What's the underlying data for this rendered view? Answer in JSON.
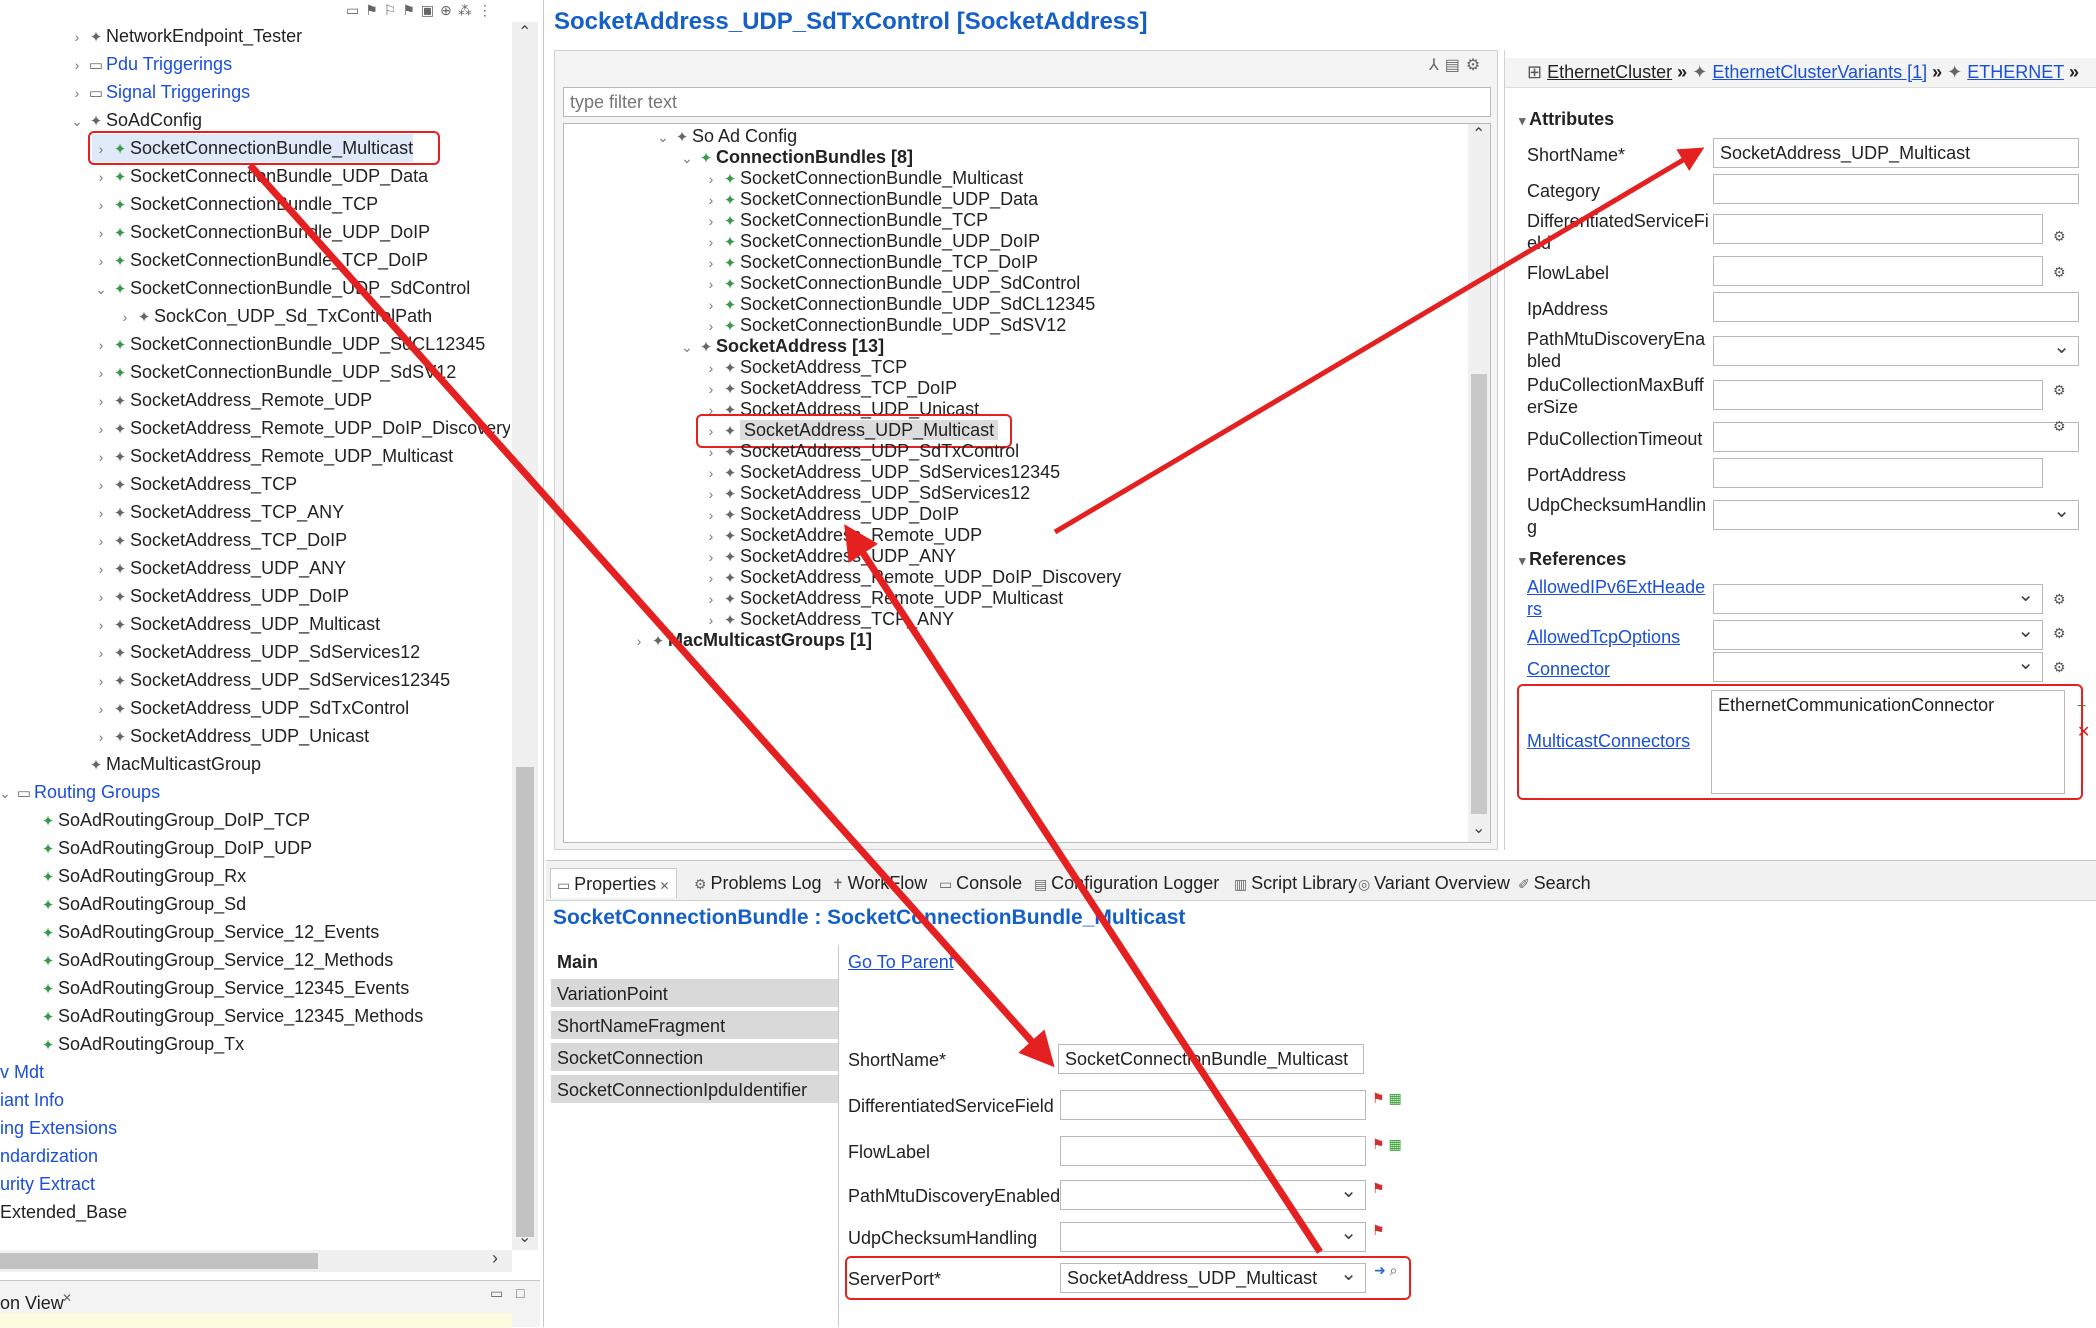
{
  "left_tree": {
    "items": [
      {
        "label": "NetworkEndpoint_Tester",
        "indent": 3,
        "chev": "›",
        "icon": "✦",
        "iconClass": "d",
        "cls": ""
      },
      {
        "label": "Pdu Triggerings",
        "indent": 3,
        "chev": "›",
        "icon": "▭",
        "iconClass": "d",
        "cls": "blue"
      },
      {
        "label": "Signal Triggerings",
        "indent": 3,
        "chev": "›",
        "icon": "▭",
        "iconClass": "d",
        "cls": "blue"
      },
      {
        "label": "SoAdConfig",
        "indent": 3,
        "chev": "⌄",
        "icon": "✦",
        "iconClass": "d",
        "cls": ""
      },
      {
        "label": "SocketConnectionBundle_Multicast",
        "indent": 4,
        "chev": "›",
        "icon": "✦",
        "iconClass": "g",
        "cls": "sel"
      },
      {
        "label": "SocketConnectionBundle_UDP_Data",
        "indent": 4,
        "chev": "›",
        "icon": "✦",
        "iconClass": "g",
        "cls": ""
      },
      {
        "label": "SocketConnectionBundle_TCP",
        "indent": 4,
        "chev": "›",
        "icon": "✦",
        "iconClass": "g",
        "cls": ""
      },
      {
        "label": "SocketConnectionBundle_UDP_DoIP",
        "indent": 4,
        "chev": "›",
        "icon": "✦",
        "iconClass": "g",
        "cls": ""
      },
      {
        "label": "SocketConnectionBundle_TCP_DoIP",
        "indent": 4,
        "chev": "›",
        "icon": "✦",
        "iconClass": "g",
        "cls": ""
      },
      {
        "label": "SocketConnectionBundle_UDP_SdControl",
        "indent": 4,
        "chev": "⌄",
        "icon": "✦",
        "iconClass": "g",
        "cls": ""
      },
      {
        "label": "SockCon_UDP_Sd_TxControlPath",
        "indent": 5,
        "chev": "›",
        "icon": "✦",
        "iconClass": "d",
        "cls": ""
      },
      {
        "label": "SocketConnectionBundle_UDP_SdCL12345",
        "indent": 4,
        "chev": "›",
        "icon": "✦",
        "iconClass": "g",
        "cls": ""
      },
      {
        "label": "SocketConnectionBundle_UDP_SdSV12",
        "indent": 4,
        "chev": "›",
        "icon": "✦",
        "iconClass": "g",
        "cls": ""
      },
      {
        "label": "SocketAddress_Remote_UDP",
        "indent": 4,
        "chev": "›",
        "icon": "✦",
        "iconClass": "d",
        "cls": ""
      },
      {
        "label": "SocketAddress_Remote_UDP_DoIP_Discovery",
        "indent": 4,
        "chev": "›",
        "icon": "✦",
        "iconClass": "d",
        "cls": ""
      },
      {
        "label": "SocketAddress_Remote_UDP_Multicast",
        "indent": 4,
        "chev": "›",
        "icon": "✦",
        "iconClass": "d",
        "cls": ""
      },
      {
        "label": "SocketAddress_TCP",
        "indent": 4,
        "chev": "›",
        "icon": "✦",
        "iconClass": "d",
        "cls": ""
      },
      {
        "label": "SocketAddress_TCP_ANY",
        "indent": 4,
        "chev": "›",
        "icon": "✦",
        "iconClass": "d",
        "cls": ""
      },
      {
        "label": "SocketAddress_TCP_DoIP",
        "indent": 4,
        "chev": "›",
        "icon": "✦",
        "iconClass": "d",
        "cls": ""
      },
      {
        "label": "SocketAddress_UDP_ANY",
        "indent": 4,
        "chev": "›",
        "icon": "✦",
        "iconClass": "d",
        "cls": ""
      },
      {
        "label": "SocketAddress_UDP_DoIP",
        "indent": 4,
        "chev": "›",
        "icon": "✦",
        "iconClass": "d",
        "cls": ""
      },
      {
        "label": "SocketAddress_UDP_Multicast",
        "indent": 4,
        "chev": "›",
        "icon": "✦",
        "iconClass": "d",
        "cls": ""
      },
      {
        "label": "SocketAddress_UDP_SdServices12",
        "indent": 4,
        "chev": "›",
        "icon": "✦",
        "iconClass": "d",
        "cls": ""
      },
      {
        "label": "SocketAddress_UDP_SdServices12345",
        "indent": 4,
        "chev": "›",
        "icon": "✦",
        "iconClass": "d",
        "cls": ""
      },
      {
        "label": "SocketAddress_UDP_SdTxControl",
        "indent": 4,
        "chev": "›",
        "icon": "✦",
        "iconClass": "d",
        "cls": ""
      },
      {
        "label": "SocketAddress_UDP_Unicast",
        "indent": 4,
        "chev": "›",
        "icon": "✦",
        "iconClass": "d",
        "cls": ""
      },
      {
        "label": "MacMulticastGroup",
        "indent": 3,
        "chev": "",
        "icon": "✦",
        "iconClass": "d",
        "cls": ""
      },
      {
        "label": "Routing Groups",
        "indent": 0,
        "chev": "⌄",
        "icon": "▭",
        "iconClass": "d",
        "cls": "blue"
      },
      {
        "label": "SoAdRoutingGroup_DoIP_TCP",
        "indent": 1,
        "chev": "",
        "icon": "✦",
        "iconClass": "g",
        "cls": ""
      },
      {
        "label": "SoAdRoutingGroup_DoIP_UDP",
        "indent": 1,
        "chev": "",
        "icon": "✦",
        "iconClass": "g",
        "cls": ""
      },
      {
        "label": "SoAdRoutingGroup_Rx",
        "indent": 1,
        "chev": "",
        "icon": "✦",
        "iconClass": "g",
        "cls": ""
      },
      {
        "label": "SoAdRoutingGroup_Sd",
        "indent": 1,
        "chev": "",
        "icon": "✦",
        "iconClass": "g",
        "cls": ""
      },
      {
        "label": "SoAdRoutingGroup_Service_12_Events",
        "indent": 1,
        "chev": "",
        "icon": "✦",
        "iconClass": "g",
        "cls": ""
      },
      {
        "label": "SoAdRoutingGroup_Service_12_Methods",
        "indent": 1,
        "chev": "",
        "icon": "✦",
        "iconClass": "g",
        "cls": ""
      },
      {
        "label": "SoAdRoutingGroup_Service_12345_Events",
        "indent": 1,
        "chev": "",
        "icon": "✦",
        "iconClass": "g",
        "cls": ""
      },
      {
        "label": "SoAdRoutingGroup_Service_12345_Methods",
        "indent": 1,
        "chev": "",
        "icon": "✦",
        "iconClass": "g",
        "cls": ""
      },
      {
        "label": "SoAdRoutingGroup_Tx",
        "indent": 1,
        "chev": "",
        "icon": "✦",
        "iconClass": "g",
        "cls": ""
      },
      {
        "label": "v Mdt",
        "indent": -2,
        "chev": "",
        "icon": "",
        "iconClass": "",
        "cls": "blue"
      },
      {
        "label": "iant Info",
        "indent": -2,
        "chev": "",
        "icon": "",
        "iconClass": "",
        "cls": "blue"
      },
      {
        "label": "ing Extensions",
        "indent": -2,
        "chev": "",
        "icon": "",
        "iconClass": "",
        "cls": "blue"
      },
      {
        "label": "ndardization",
        "indent": -2,
        "chev": "",
        "icon": "",
        "iconClass": "",
        "cls": "blue"
      },
      {
        "label": "urity Extract",
        "indent": -2,
        "chev": "",
        "icon": "",
        "iconClass": "",
        "cls": "blue"
      },
      {
        "label": "Extended_Base",
        "indent": -2,
        "chev": "",
        "icon": "",
        "iconClass": "",
        "cls": ""
      }
    ],
    "bottom_view_title": "on View"
  },
  "editor": {
    "title": "SocketAddress_UDP_SdTxControl [SocketAddress]",
    "filter_placeholder": "type filter text",
    "tree": [
      {
        "label": "So Ad Config",
        "indent": 0,
        "chev": "⌄",
        "icon": "✦",
        "iconClass": "d",
        "bold": false
      },
      {
        "label": "ConnectionBundles [8]",
        "indent": 1,
        "chev": "⌄",
        "icon": "✦",
        "iconClass": "g",
        "bold": true
      },
      {
        "label": "SocketConnectionBundle_Multicast",
        "indent": 2,
        "chev": "›",
        "icon": "✦",
        "iconClass": "g",
        "bold": false
      },
      {
        "label": "SocketConnectionBundle_UDP_Data",
        "indent": 2,
        "chev": "›",
        "icon": "✦",
        "iconClass": "g",
        "bold": false
      },
      {
        "label": "SocketConnectionBundle_TCP",
        "indent": 2,
        "chev": "›",
        "icon": "✦",
        "iconClass": "g",
        "bold": false
      },
      {
        "label": "SocketConnectionBundle_UDP_DoIP",
        "indent": 2,
        "chev": "›",
        "icon": "✦",
        "iconClass": "g",
        "bold": false
      },
      {
        "label": "SocketConnectionBundle_TCP_DoIP",
        "indent": 2,
        "chev": "›",
        "icon": "✦",
        "iconClass": "g",
        "bold": false
      },
      {
        "label": "SocketConnectionBundle_UDP_SdControl",
        "indent": 2,
        "chev": "›",
        "icon": "✦",
        "iconClass": "g",
        "bold": false
      },
      {
        "label": "SocketConnectionBundle_UDP_SdCL12345",
        "indent": 2,
        "chev": "›",
        "icon": "✦",
        "iconClass": "g",
        "bold": false
      },
      {
        "label": "SocketConnectionBundle_UDP_SdSV12",
        "indent": 2,
        "chev": "›",
        "icon": "✦",
        "iconClass": "g",
        "bold": false
      },
      {
        "label": "SocketAddress [13]",
        "indent": 1,
        "chev": "⌄",
        "icon": "✦",
        "iconClass": "d",
        "bold": true
      },
      {
        "label": "SocketAddress_TCP",
        "indent": 2,
        "chev": "›",
        "icon": "✦",
        "iconClass": "d",
        "bold": false
      },
      {
        "label": "SocketAddress_TCP_DoIP",
        "indent": 2,
        "chev": "›",
        "icon": "✦",
        "iconClass": "d",
        "bold": false
      },
      {
        "label": "SocketAddress_UDP_Unicast",
        "indent": 2,
        "chev": "›",
        "icon": "✦",
        "iconClass": "d",
        "bold": false
      },
      {
        "label": "SocketAddress_UDP_Multicast",
        "indent": 2,
        "chev": "›",
        "icon": "✦",
        "iconClass": "d",
        "bold": false,
        "sel": true
      },
      {
        "label": "SocketAddress_UDP_SdTxControl",
        "indent": 2,
        "chev": "›",
        "icon": "✦",
        "iconClass": "d",
        "bold": false
      },
      {
        "label": "SocketAddress_UDP_SdServices12345",
        "indent": 2,
        "chev": "›",
        "icon": "✦",
        "iconClass": "d",
        "bold": false
      },
      {
        "label": "SocketAddress_UDP_SdServices12",
        "indent": 2,
        "chev": "›",
        "icon": "✦",
        "iconClass": "d",
        "bold": false
      },
      {
        "label": "SocketAddress_UDP_DoIP",
        "indent": 2,
        "chev": "›",
        "icon": "✦",
        "iconClass": "d",
        "bold": false
      },
      {
        "label": "SocketAddress_Remote_UDP",
        "indent": 2,
        "chev": "›",
        "icon": "✦",
        "iconClass": "d",
        "bold": false
      },
      {
        "label": "SocketAddress_UDP_ANY",
        "indent": 2,
        "chev": "›",
        "icon": "✦",
        "iconClass": "d",
        "bold": false
      },
      {
        "label": "SocketAddress_Remote_UDP_DoIP_Discovery",
        "indent": 2,
        "chev": "›",
        "icon": "✦",
        "iconClass": "d",
        "bold": false
      },
      {
        "label": "SocketAddress_Remote_UDP_Multicast",
        "indent": 2,
        "chev": "›",
        "icon": "✦",
        "iconClass": "d",
        "bold": false
      },
      {
        "label": "SocketAddress_TCP_ANY",
        "indent": 2,
        "chev": "›",
        "icon": "✦",
        "iconClass": "d",
        "bold": false
      },
      {
        "label": "MacMulticastGroups [1]",
        "indent": -1,
        "chev": "›",
        "icon": "✦",
        "iconClass": "d",
        "bold": true
      }
    ]
  },
  "attributes": {
    "breadcrumb": [
      "EthernetCluster",
      "EthernetClusterVariants [1]",
      "ETHERNET"
    ],
    "breadcrumb_sep": "»",
    "section_attributes": "Attributes",
    "section_references": "References",
    "shortname_label": "ShortName*",
    "shortname_value": "SocketAddress_UDP_Multicast",
    "category_label": "Category",
    "dsf_label": "DifferentiatedServiceFi eld",
    "flowlabel_label": "FlowLabel",
    "ipaddress_label": "IpAddress",
    "pathmtu_label": "PathMtuDiscoveryEna bled",
    "pdumax_label": "PduCollectionMaxBuff erSize",
    "pdutimeout_label": "PduCollectionTimeout",
    "port_label": "PortAddress",
    "udpcs_label": "UdpChecksumHandlin g",
    "allowed_ipv6_label": "AllowedIPv6ExtHeade rs",
    "allowed_tcp_label": "AllowedTcpOptions",
    "connector_label": "Connector",
    "multicast_label": "MulticastConnectors",
    "multicast_value": "EthernetCommunicationConnector"
  },
  "bottom_tabs": [
    "Properties",
    "Problems Log",
    "WorkFlow",
    "Console",
    "Configuration Logger",
    "Script Library",
    "Variant Overview",
    "Search"
  ],
  "properties": {
    "title": "SocketConnectionBundle : SocketConnectionBundle_Multicast",
    "side_tabs": [
      "Main",
      "VariationPoint",
      "ShortNameFragment",
      "SocketConnection",
      "SocketConnectionIpduIdentifier"
    ],
    "go_to_parent": "Go To Parent",
    "shortname_label": "ShortName*",
    "shortname_value": "SocketConnectionBundle_Multicast",
    "dsf_label": "DifferentiatedServiceField",
    "flowlabel_label": "FlowLabel",
    "pathmtu_label": "PathMtuDiscoveryEnabled",
    "udpcs_label": "UdpChecksumHandling",
    "serverport_label": "ServerPort*",
    "serverport_value": "SocketAddress_UDP_Multicast"
  },
  "colors": {
    "annotation_red": "#e52020",
    "link_blue": "#1a4fd6",
    "title_blue": "#1560c8"
  }
}
